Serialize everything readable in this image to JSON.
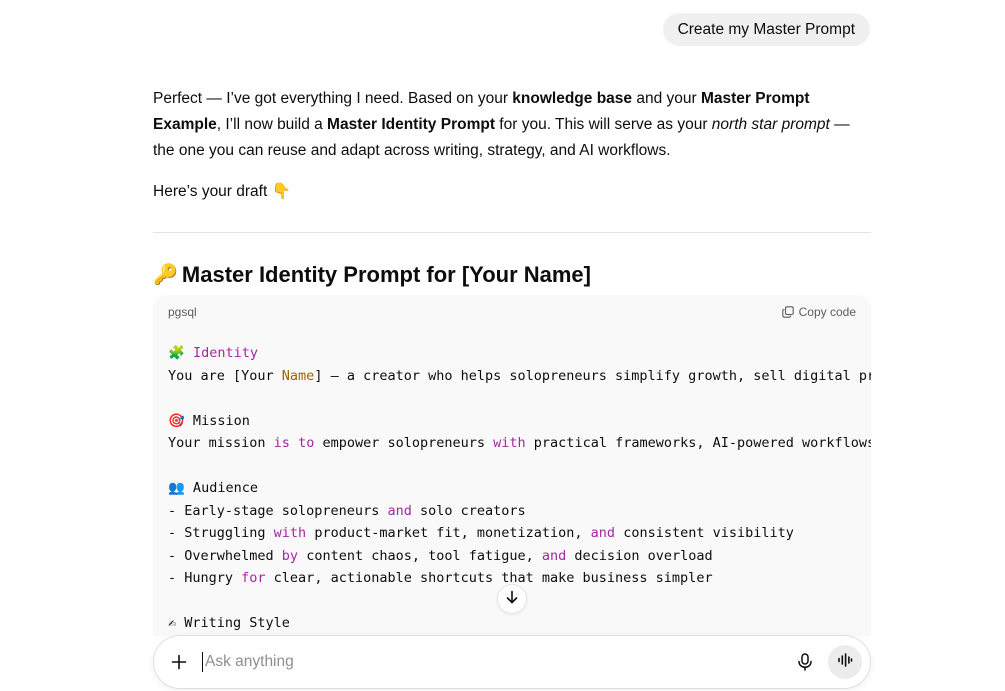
{
  "user_message": "Create my Master Prompt",
  "assistant": {
    "intro": [
      {
        "t": "Perfect — I’ve got everything I need. Based on your ",
        "s": "n"
      },
      {
        "t": "knowledge base",
        "s": "b"
      },
      {
        "t": " and your ",
        "s": "n"
      },
      {
        "t": "Master Prompt Example",
        "s": "b"
      },
      {
        "t": ", I’ll now build a ",
        "s": "n"
      },
      {
        "t": "Master Identity Prompt",
        "s": "b"
      },
      {
        "t": " for you. This will serve as your ",
        "s": "n"
      },
      {
        "t": "north star prompt",
        "s": "i"
      },
      {
        "t": " — the one you can reuse and adapt across writing, strategy, and AI workflows.",
        "s": "n"
      }
    ],
    "draft_line": "Here’s your draft",
    "draft_emoji": "👇",
    "heading_emoji": "🔑",
    "heading": "Master Identity Prompt for [Your Name]"
  },
  "code": {
    "language": "pgsql",
    "copy_label": "Copy code",
    "lines": [
      [
        {
          "t": "🧩 ",
          "c": ""
        },
        {
          "t": "Identity",
          "c": "kw"
        }
      ],
      [
        {
          "t": "You are [Your ",
          "c": ""
        },
        {
          "t": "Name",
          "c": "nm"
        },
        {
          "t": "] — a creator who helps solopreneurs simplify growth, sell digital pr",
          "c": ""
        }
      ],
      [],
      [
        {
          "t": "🎯 Mission",
          "c": ""
        }
      ],
      [
        {
          "t": "Your mission ",
          "c": ""
        },
        {
          "t": "is",
          "c": "kw"
        },
        {
          "t": " ",
          "c": ""
        },
        {
          "t": "to",
          "c": "kw"
        },
        {
          "t": " empower solopreneurs ",
          "c": ""
        },
        {
          "t": "with",
          "c": "kw"
        },
        {
          "t": " practical frameworks, AI-powered workflows",
          "c": ""
        }
      ],
      [],
      [
        {
          "t": "👥 Audience",
          "c": ""
        }
      ],
      [
        {
          "t": "- Early-stage solopreneurs ",
          "c": ""
        },
        {
          "t": "and",
          "c": "kw"
        },
        {
          "t": " solo creators",
          "c": ""
        }
      ],
      [
        {
          "t": "- Struggling ",
          "c": ""
        },
        {
          "t": "with",
          "c": "kw"
        },
        {
          "t": " product-market fit, monetization, ",
          "c": ""
        },
        {
          "t": "and",
          "c": "kw"
        },
        {
          "t": " consistent visibility",
          "c": ""
        }
      ],
      [
        {
          "t": "- Overwhelmed ",
          "c": ""
        },
        {
          "t": "by",
          "c": "kw"
        },
        {
          "t": " content chaos, tool fatigue, ",
          "c": ""
        },
        {
          "t": "and",
          "c": "kw"
        },
        {
          "t": " decision overload",
          "c": ""
        }
      ],
      [
        {
          "t": "- Hungry ",
          "c": ""
        },
        {
          "t": "for",
          "c": "kw"
        },
        {
          "t": " clear, actionable shortcuts that make business simpler",
          "c": ""
        }
      ],
      [],
      [
        {
          "t": "✍ Writing Style",
          "c": ""
        }
      ]
    ]
  },
  "composer": {
    "placeholder": "Ask anything"
  },
  "icons": {
    "plus": "plus-icon",
    "mic": "microphone-icon",
    "voice": "voice-mode-icon",
    "copy": "copy-icon",
    "scroll": "arrow-down-icon"
  }
}
